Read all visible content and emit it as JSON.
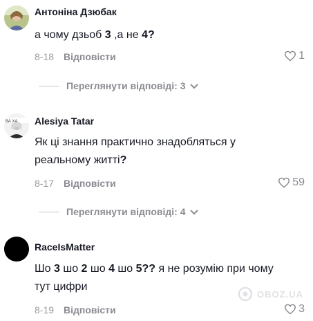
{
  "comments": [
    {
      "username": "Антоніна Дзюбак",
      "text_parts": [
        "а чому дзьоб ",
        "3",
        " ,а не ",
        "4?"
      ],
      "date": "8-18",
      "reply_label": "Відповісти",
      "likes": "1",
      "view_replies": "Переглянути відповіді: 3",
      "avatar": "photo-woman-icon"
    },
    {
      "username": "Alesiya Tatar",
      "text_parts": [
        "Як ці знання практично знадобляться у реальному житті",
        "?"
      ],
      "date": "8-17",
      "reply_label": "Відповісти",
      "likes": "59",
      "view_replies": "Переглянути відповіді: 4",
      "avatar": "photo-woman-bw-icon"
    },
    {
      "username": "RaceIsMatter",
      "text_parts": [
        "Шо ",
        "3",
        " шо ",
        "2",
        " шо ",
        "4",
        " шо ",
        "5??",
        " я не розумію при чому тут цифри"
      ],
      "date": "8-19",
      "reply_label": "Відповісти",
      "likes": "3",
      "avatar": "black-circle-avatar"
    }
  ],
  "watermark": "OBOZ.UA",
  "colors": {
    "text": "#161823",
    "muted": "#8a8b91",
    "background": "#ffffff"
  }
}
